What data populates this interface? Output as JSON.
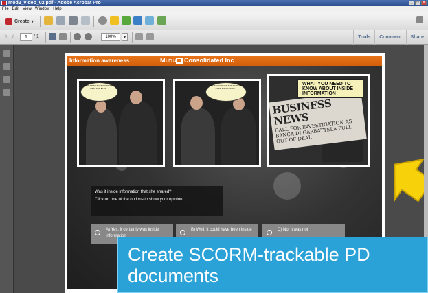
{
  "window": {
    "title": "mod2_video_02.pdf - Adobe Acrobat Pro",
    "controls": [
      "_",
      "□",
      "x"
    ]
  },
  "menu": {
    "items": [
      "File",
      "Edit",
      "View",
      "Window",
      "Help"
    ]
  },
  "toolbar": {
    "create_label": "Create",
    "page_current": "1",
    "page_total": "/ 1",
    "zoom": "100%",
    "right_tabs": [
      "Tools",
      "Comment",
      "Share"
    ]
  },
  "slide": {
    "header_left": "Information awareness",
    "company": "Mutual",
    "company_suffix": "Consolidated Inc",
    "bubble1": "WOULD MEAN I'M WORKING WITH THE BANK...",
    "bubble2": "THAT WAY WHEN THE MERGER GETS ANNOUNCED...",
    "callout": "WHAT YOU NEED TO KNOW ABOUT INSIDE INFORMATION",
    "newspaper_title": "BUSINESS NEWS",
    "newspaper_sub": "CALL FOR INVESTIGATION AS BANCA DI GARBATTELA PULL OUT OF DEAL",
    "question_line1": "Was it inside information that she shared?",
    "question_line2": "Click on one of the options to show your opinion.",
    "options": [
      "A) Yes, it certainly was inside information",
      "B) Well, it could have been inside",
      "C) No, it was not"
    ]
  },
  "banner": {
    "line1": "Create SCORM-trackable PD",
    "line2": "documents"
  },
  "colors": {
    "orange": "#e8751a",
    "banner_blue": "#2aa2d7",
    "arrow_yellow": "#f7d20b"
  }
}
